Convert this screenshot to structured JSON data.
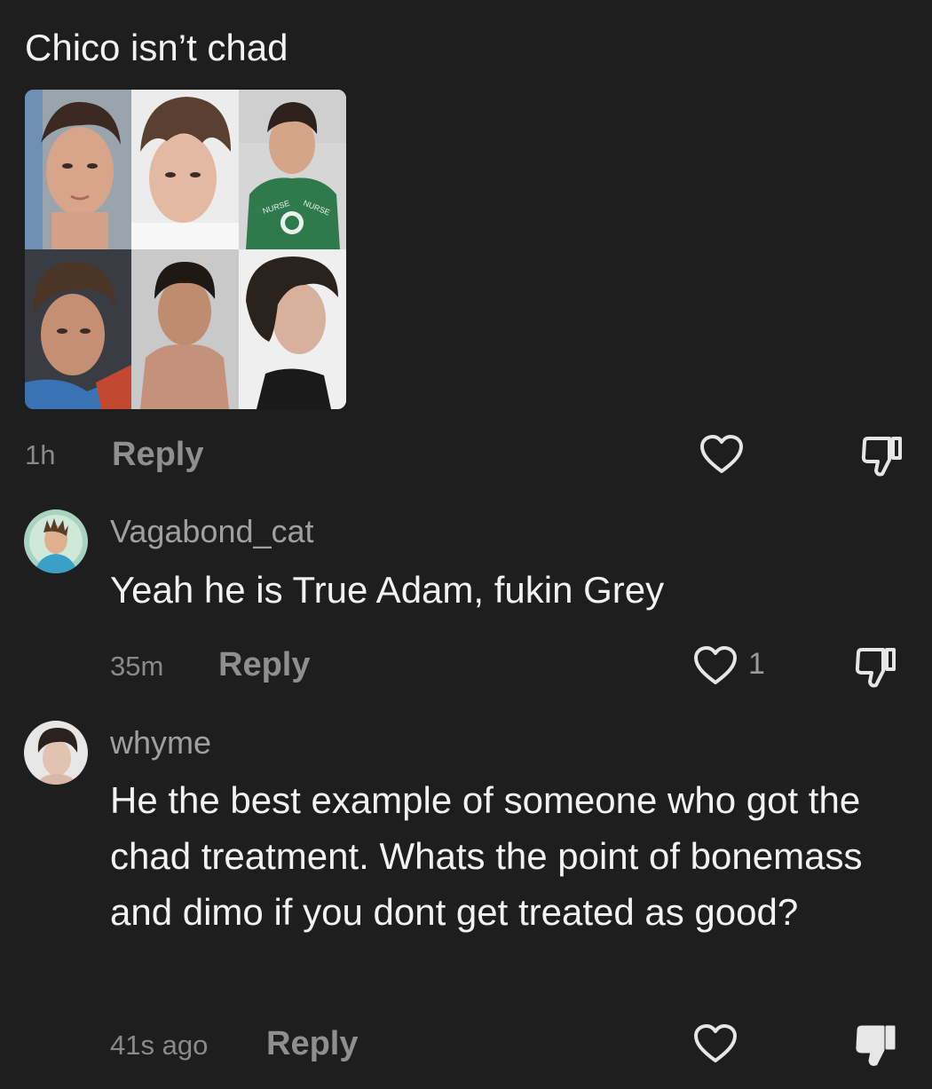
{
  "top_comment": {
    "text": "Chico isn’t chad",
    "time": "1h",
    "reply_label": "Reply"
  },
  "replies": [
    {
      "username": "Vagabond_cat",
      "text": "Yeah he is True Adam, fukin Grey",
      "time": "35m",
      "reply_label": "Reply",
      "like_count": "1"
    },
    {
      "username": "whyme",
      "text": "He the best example of someone who got the chad treatment. Whats the point of bonemass and dimo if you dont get treated as good?",
      "time": "41s ago",
      "reply_label": "Reply"
    }
  ],
  "shirt_lettering": "NURSE",
  "colors": {
    "background": "#1e1e1e",
    "text": "#f2f2f2",
    "muted": "#8f8f8f"
  },
  "icons": [
    "heart-icon",
    "dislike-icon",
    "dislike-filled-icon"
  ]
}
